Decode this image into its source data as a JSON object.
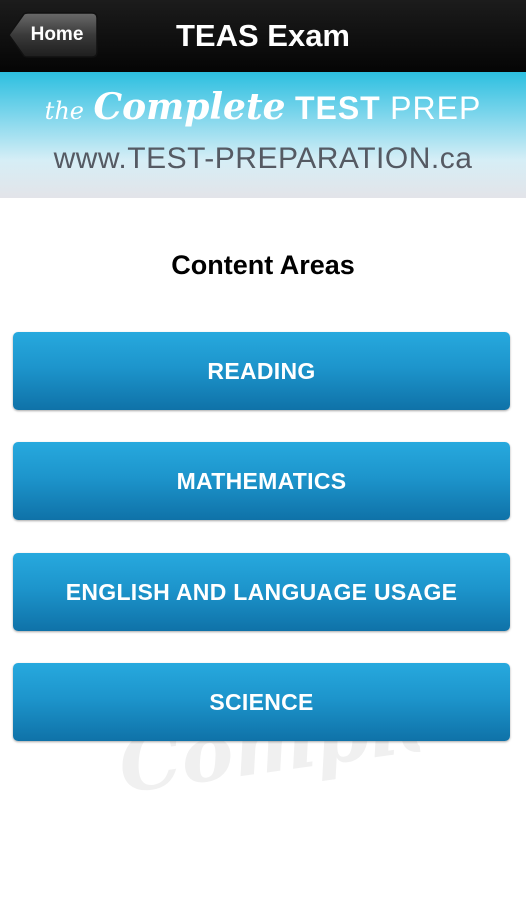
{
  "navbar": {
    "home_label": "Home",
    "title": "TEAS Exam"
  },
  "banner": {
    "brand_the": "the",
    "brand_complete": "Complete",
    "brand_test": "TEST",
    "brand_prep": "PREP",
    "url": "www.TEST-PREPARATION.ca"
  },
  "content": {
    "title": "Content Areas",
    "areas": [
      "READING",
      "MATHEMATICS",
      "ENGLISH AND LANGUAGE USAGE",
      "SCIENCE"
    ],
    "watermark": "Complete"
  },
  "colors": {
    "navbar": "#0a0a0a",
    "button_top": "#27a9de",
    "button_bottom": "#0f72a8",
    "banner_top": "#2cbfe0"
  }
}
